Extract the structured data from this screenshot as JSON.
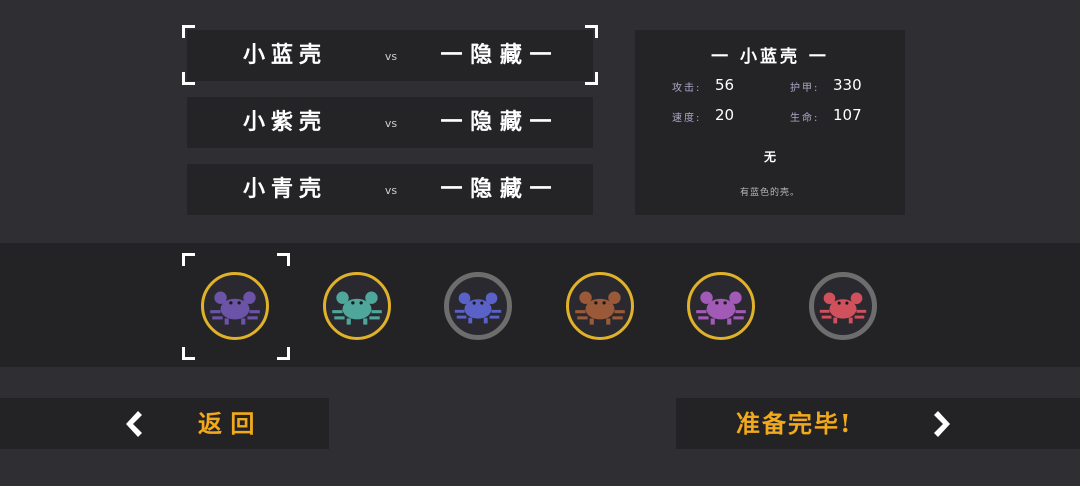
{
  "matchups": [
    {
      "name": "小蓝壳",
      "vs": "vs",
      "opponent": "一 隐 藏 一"
    },
    {
      "name": "小紫壳",
      "vs": "vs",
      "opponent": "一 隐 藏 一"
    },
    {
      "name": "小青壳",
      "vs": "vs",
      "opponent": "一 隐 藏 一"
    }
  ],
  "info": {
    "title": "一 小蓝壳 一",
    "attack_label": "攻击:",
    "attack_value": "56",
    "armor_label": "护甲:",
    "armor_value": "330",
    "speed_label": "速度:",
    "speed_value": "20",
    "hp_label": "生命:",
    "hp_value": "107",
    "ability": "无",
    "description": "有蓝色的壳。"
  },
  "crabs": [
    {
      "name": "purple-crab",
      "ring": "gold",
      "color": "#6b54a8",
      "selected": true
    },
    {
      "name": "teal-crab",
      "ring": "gold",
      "color": "#4fa69a",
      "selected": false
    },
    {
      "name": "blue-crab",
      "ring": "gray",
      "color": "#5a62c8",
      "selected": false
    },
    {
      "name": "brown-crab",
      "ring": "gold",
      "color": "#9a5a3a",
      "selected": false
    },
    {
      "name": "violet-crab",
      "ring": "gold",
      "color": "#a15ab6",
      "selected": false
    },
    {
      "name": "red-crab",
      "ring": "gray",
      "color": "#d0505c",
      "selected": false
    }
  ],
  "buttons": {
    "back": "返 回",
    "ready": "准备完毕!"
  },
  "colors": {
    "background": "#2f2e33",
    "panel": "#242326",
    "accent": "#f2a91c",
    "gold_ring": "#e0b22a",
    "gray_ring": "#6d6d6d"
  }
}
